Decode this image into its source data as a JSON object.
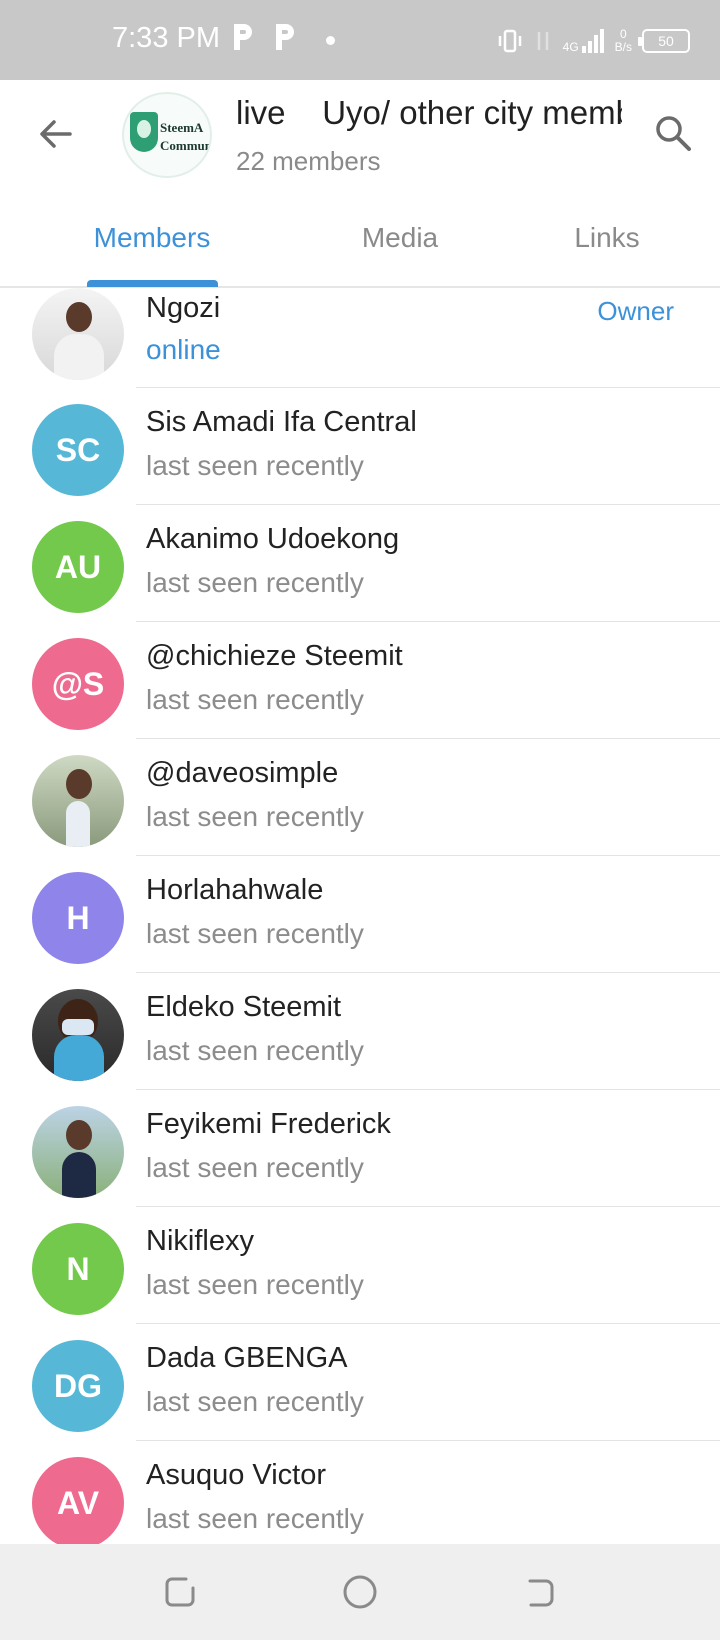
{
  "status_bar": {
    "time": "7:33 PM",
    "network": "4G",
    "speed_value": "0",
    "speed_unit": "B/s",
    "battery": "50"
  },
  "header": {
    "title": "live    Uyo/ other city members",
    "subtitle": "22 members",
    "avatar_text_line1": "SteemA",
    "avatar_text_line2": "Commun"
  },
  "tabs": [
    {
      "label": "Members",
      "active": true
    },
    {
      "label": "Media",
      "active": false
    },
    {
      "label": "Links",
      "active": false
    }
  ],
  "members": [
    {
      "name": "Ngozi",
      "status": "online",
      "role": "Owner"
    },
    {
      "name": "Sis Amadi Ifa Central",
      "status": "last seen recently",
      "initials": "SC",
      "color": "#56b8d6"
    },
    {
      "name": "Akanimo Udoekong",
      "status": "last seen recently",
      "initials": "AU",
      "color": "#73c94b"
    },
    {
      "name": "@chichieze Steemit",
      "status": "last seen recently",
      "initials": "@S",
      "color": "#ef6a8f"
    },
    {
      "name": "@daveosimple",
      "status": "last seen recently"
    },
    {
      "name": "Horlahahwale",
      "status": "last seen recently",
      "initials": "H",
      "color": "#8f84ea"
    },
    {
      "name": "Eldeko Steemit",
      "status": "last seen recently"
    },
    {
      "name": "Feyikemi Frederick",
      "status": "last seen recently"
    },
    {
      "name": "Nikiflexy",
      "status": "last seen recently",
      "initials": "N",
      "color": "#73c94b"
    },
    {
      "name": "Dada GBENGA",
      "status": "last seen recently",
      "initials": "DG",
      "color": "#56b8d6"
    },
    {
      "name": "Asuquo Victor",
      "status": "last seen recently",
      "initials": "AV",
      "color": "#ef6a8f"
    }
  ]
}
